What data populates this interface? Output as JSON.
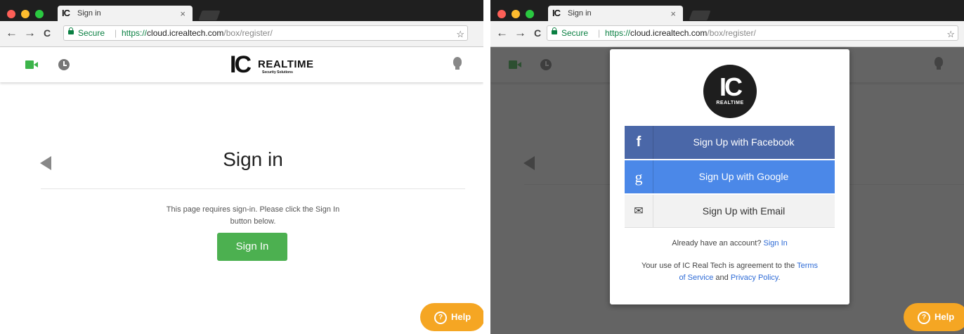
{
  "browser": {
    "tab_favicon": "IC",
    "tab_title": "Sign in",
    "tab_close": "×",
    "secure_label": "Secure",
    "url_protocol": "https://",
    "url_host": "cloud.icrealtech.com",
    "url_path": "/box/register/",
    "back": "←",
    "forward": "→",
    "reload": "C",
    "star": "☆"
  },
  "header": {
    "logo_ic": "IC",
    "logo_brand": "REALTIME",
    "logo_tagline": "Security Solutions"
  },
  "signin_page": {
    "title": "Sign in",
    "message": "This page requires sign-in. Please click the Sign In button below.",
    "button": "Sign In"
  },
  "modal": {
    "logo_ic": "IC",
    "logo_text": "REALTIME",
    "facebook_icon": "f",
    "facebook": "Sign Up with Facebook",
    "google_icon": "g",
    "google": "Sign Up with Google",
    "email_icon": "✉",
    "email": "Sign Up with Email",
    "have_account": "Already have an account?",
    "signin_link": "Sign In",
    "terms_prefix": "Your use of IC Real Tech is agreement to the",
    "terms_link": "Terms of Service",
    "and": "and",
    "privacy_link": "Privacy Policy",
    "period": "."
  },
  "help": {
    "icon": "?",
    "label": "Help"
  },
  "colors": {
    "green": "#4cb050",
    "facebook": "#4a67a8",
    "google": "#4b88e8",
    "help": "#f5a623"
  }
}
